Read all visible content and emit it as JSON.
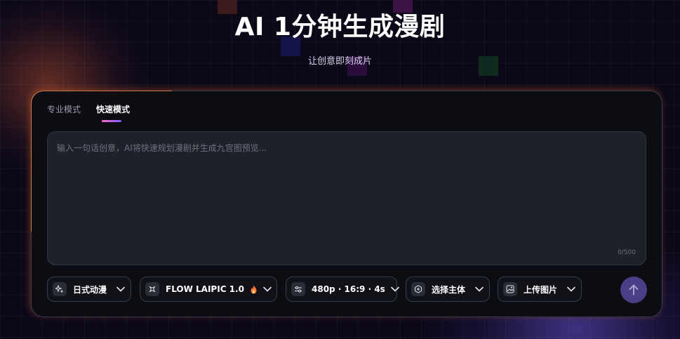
{
  "hero": {
    "title": "AI 1分钟生成漫剧",
    "subtitle": "让创意即刻成片"
  },
  "tabs": [
    {
      "label": "专业模式",
      "active": false
    },
    {
      "label": "快速模式",
      "active": true
    }
  ],
  "prompt": {
    "value": "",
    "placeholder": "输入一句话创意，AI将快速规划漫剧并生成九宫图预览...",
    "char_count": "0/500"
  },
  "toolbar": {
    "style": {
      "label": "日式动漫",
      "icon": "sparkles-icon"
    },
    "model": {
      "label": "FLOW LAIPIC 1.0",
      "icon": "model-icon",
      "badge_icon": "fire-icon"
    },
    "video_settings": {
      "label": "480p · 16:9 · 4s",
      "icon": "sliders-icon"
    },
    "subject": {
      "label": "选择主体",
      "icon": "subject-add-icon"
    },
    "upload": {
      "label": "上传图片",
      "icon": "image-upload-icon"
    },
    "send_icon": "arrow-up-icon"
  },
  "colors": {
    "accent": "#7b5cff",
    "send_button": "#4a3f86",
    "tab_underline_start": "#ff6ac1",
    "tab_underline_end": "#7b5cff",
    "glow_orange": "#ff7a3d"
  }
}
